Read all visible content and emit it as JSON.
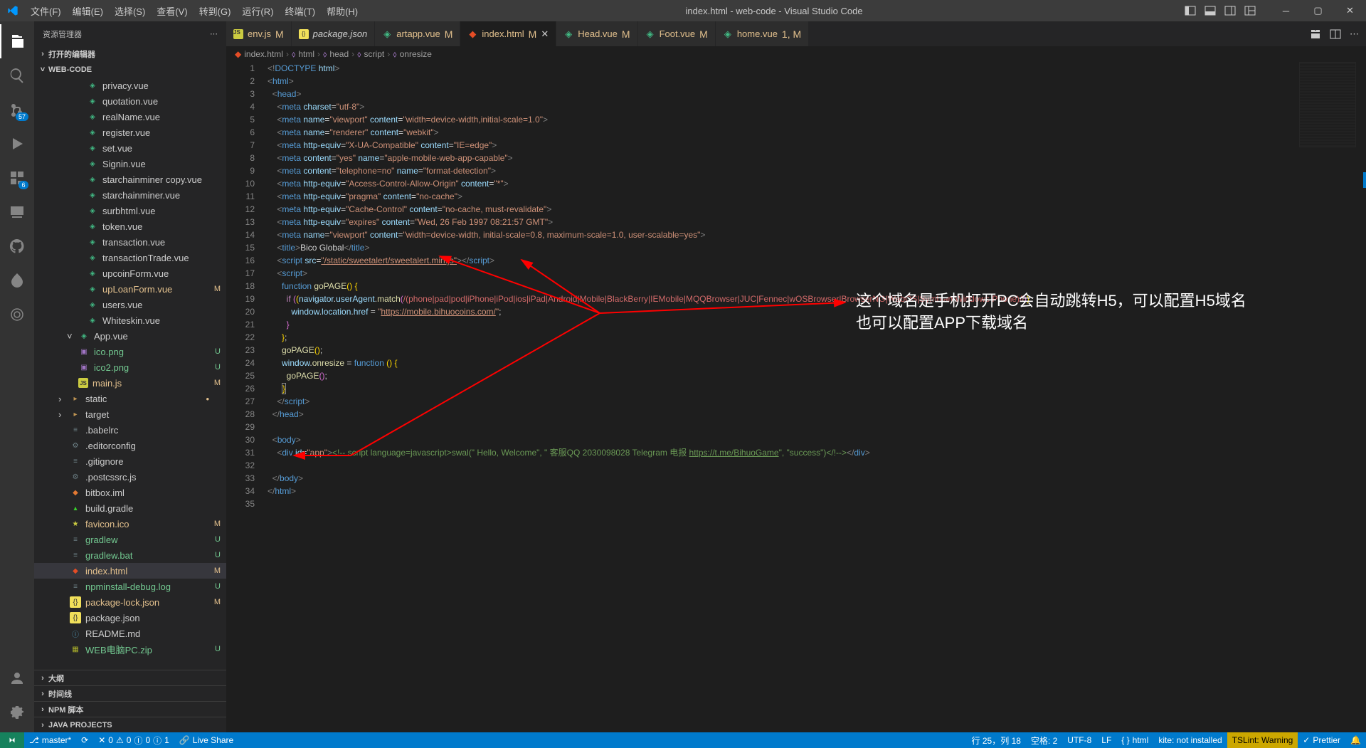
{
  "window": {
    "title": "index.html - web-code - Visual Studio Code"
  },
  "menu": [
    "文件(F)",
    "编辑(E)",
    "选择(S)",
    "查看(V)",
    "转到(G)",
    "运行(R)",
    "终端(T)",
    "帮助(H)"
  ],
  "activity": {
    "scmBadge": "57",
    "extBadge": "6"
  },
  "sidebar": {
    "title": "资源管理器",
    "openEditors": "打开的编辑器",
    "projectName": "WEB-CODE",
    "outline": "大纲",
    "timeline": "时间线",
    "npmScripts": "NPM 脚本",
    "javaProjects": "JAVA PROJECTS",
    "files": [
      {
        "icon": "vue",
        "label": "privacy.vue",
        "pad": 74
      },
      {
        "icon": "vue",
        "label": "quotation.vue",
        "pad": 74
      },
      {
        "icon": "vue",
        "label": "realName.vue",
        "pad": 74
      },
      {
        "icon": "vue",
        "label": "register.vue",
        "pad": 74
      },
      {
        "icon": "vue",
        "label": "set.vue",
        "pad": 74
      },
      {
        "icon": "vue",
        "label": "Signin.vue",
        "pad": 74
      },
      {
        "icon": "vue",
        "label": "starchainminer copy.vue",
        "pad": 74
      },
      {
        "icon": "vue",
        "label": "starchainminer.vue",
        "pad": 74
      },
      {
        "icon": "vue",
        "label": "surbhtml.vue",
        "pad": 74
      },
      {
        "icon": "vue",
        "label": "token.vue",
        "pad": 74
      },
      {
        "icon": "vue",
        "label": "transaction.vue",
        "pad": 74
      },
      {
        "icon": "vue",
        "label": "transactionTrade.vue",
        "pad": 74
      },
      {
        "icon": "vue",
        "label": "upcoinForm.vue",
        "pad": 74
      },
      {
        "icon": "vue",
        "label": "upLoanForm.vue",
        "pad": 74,
        "mod": "M"
      },
      {
        "icon": "vue",
        "label": "users.vue",
        "pad": 74
      },
      {
        "icon": "vue",
        "label": "Whiteskin.vue",
        "pad": 74
      },
      {
        "icon": "vue",
        "label": "App.vue",
        "pad": 62,
        "chev": "˅"
      },
      {
        "icon": "img",
        "label": "ico.png",
        "pad": 62,
        "mod": "U",
        "untracked": true
      },
      {
        "icon": "img",
        "label": "ico2.png",
        "pad": 62,
        "mod": "U",
        "untracked": true
      },
      {
        "icon": "js",
        "label": "main.js",
        "pad": 62,
        "mod": "M"
      },
      {
        "icon": "folder",
        "label": "static",
        "pad": 50,
        "chev": "›",
        "dot": true
      },
      {
        "icon": "folder",
        "label": "target",
        "pad": 50,
        "chev": "›"
      },
      {
        "icon": "file",
        "label": ".babelrc",
        "pad": 50
      },
      {
        "icon": "gear",
        "label": ".editorconfig",
        "pad": 50
      },
      {
        "icon": "file",
        "label": ".gitignore",
        "pad": 50
      },
      {
        "icon": "gear",
        "label": ".postcssrc.js",
        "pad": 50
      },
      {
        "icon": "xml",
        "label": "bitbox.iml",
        "pad": 50
      },
      {
        "icon": "gradle",
        "label": "build.gradle",
        "pad": 50
      },
      {
        "icon": "star",
        "label": "favicon.ico",
        "pad": 50,
        "mod": "M"
      },
      {
        "icon": "file",
        "label": "gradlew",
        "pad": 50,
        "mod": "U",
        "untracked": true
      },
      {
        "icon": "file",
        "label": "gradlew.bat",
        "pad": 50,
        "mod": "U",
        "untracked": true
      },
      {
        "icon": "html5",
        "label": "index.html",
        "pad": 50,
        "mod": "M",
        "selected": true
      },
      {
        "icon": "file",
        "label": "npminstall-debug.log",
        "pad": 50,
        "mod": "U",
        "untracked": true
      },
      {
        "icon": "json",
        "label": "package-lock.json",
        "pad": 50,
        "mod": "M"
      },
      {
        "icon": "json",
        "label": "package.json",
        "pad": 50
      },
      {
        "icon": "info",
        "label": "README.md",
        "pad": 50
      },
      {
        "icon": "zip",
        "label": "WEB电脑PC.zip",
        "pad": 50,
        "mod": "U",
        "untracked": true
      }
    ]
  },
  "tabs": [
    {
      "icon": "js",
      "label": "env.js",
      "mod": "M"
    },
    {
      "icon": "json",
      "label": "package.json",
      "italic": true
    },
    {
      "icon": "vue",
      "label": "artapp.vue",
      "mod": "M"
    },
    {
      "icon": "html5",
      "label": "index.html",
      "mod": "M",
      "active": true
    },
    {
      "icon": "vue",
      "label": "Head.vue",
      "mod": "M"
    },
    {
      "icon": "vue",
      "label": "Foot.vue",
      "mod": "M"
    },
    {
      "icon": "vue",
      "label": "home.vue",
      "mod": "1, M"
    }
  ],
  "breadcrumbs": [
    {
      "icon": "html5",
      "label": "index.html"
    },
    {
      "icon": "tag",
      "label": "html"
    },
    {
      "icon": "tag",
      "label": "head"
    },
    {
      "icon": "tag",
      "label": "script"
    },
    {
      "icon": "tag",
      "label": "onresize"
    }
  ],
  "code": {
    "lineStart": 1,
    "lineEnd": 35
  },
  "annotation": {
    "line1": "这个域名是手机打开PC会自动跳转H5，可以配置H5域名",
    "line2": "也可以配置APP下载域名"
  },
  "statusbar": {
    "branch": "master*",
    "sync": "⟳",
    "errors": "0",
    "warnings": "0",
    "port": "0",
    "info": "1",
    "liveshare": "Live Share",
    "lncol": "行 25，列 18",
    "spaces": "空格: 2",
    "encoding": "UTF-8",
    "eol": "LF",
    "lang": "html",
    "kite": "kite: not installed",
    "tslint": "TSLint: Warning",
    "prettier": "Prettier",
    "bell": "🔔"
  }
}
